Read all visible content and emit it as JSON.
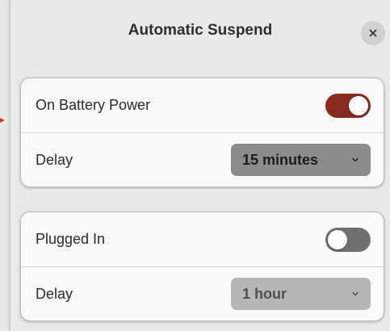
{
  "dialog": {
    "title": "Automatic Suspend",
    "close_icon": "close-icon"
  },
  "battery": {
    "label": "On Battery Power",
    "enabled": true,
    "delay_label": "Delay",
    "delay_value": "15 minutes"
  },
  "plugged": {
    "label": "Plugged In",
    "enabled": false,
    "delay_label": "Delay",
    "delay_value": "1 hour"
  },
  "colors": {
    "accent": "#8a2a1e",
    "switch_off": "#6f6f6f",
    "pointer": "#d8323a"
  }
}
